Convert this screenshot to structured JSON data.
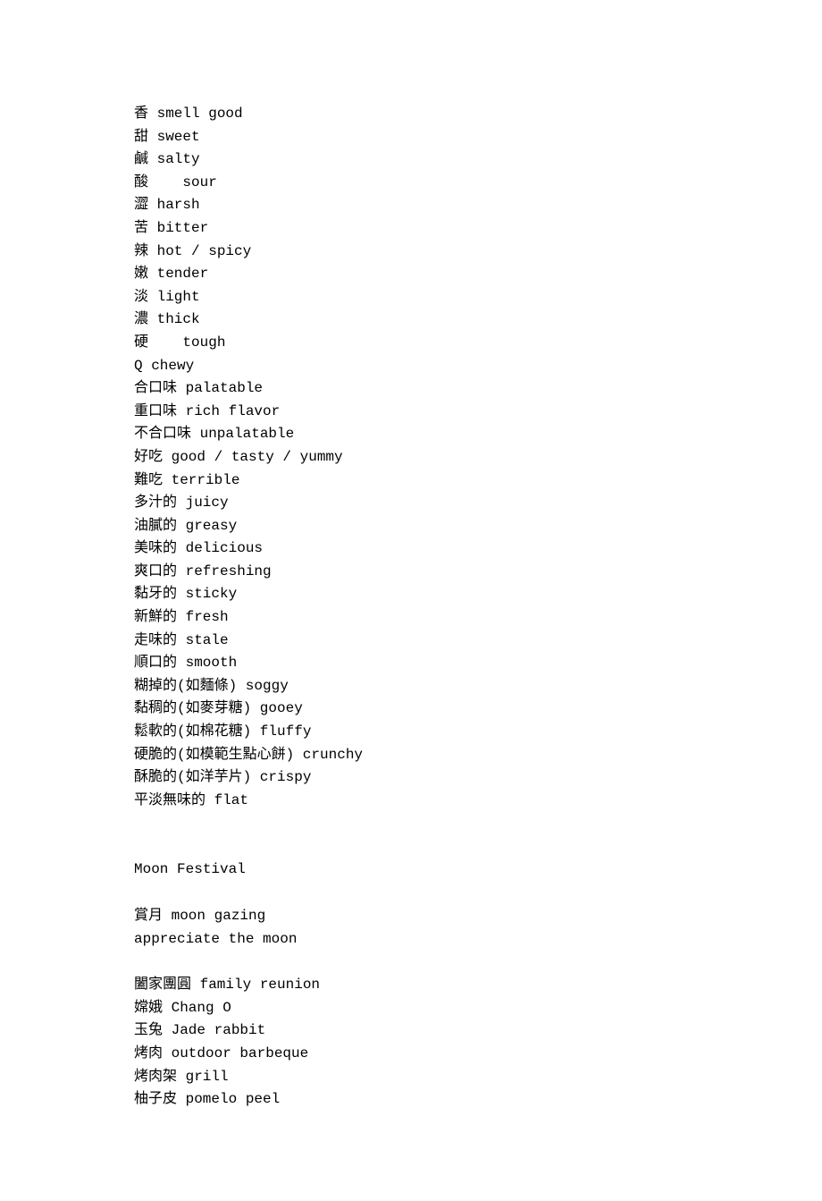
{
  "tastes": [
    {
      "cn": "香",
      "en": "smell good"
    },
    {
      "cn": "甜",
      "en": "sweet"
    },
    {
      "cn": "鹹",
      "en": "salty"
    },
    {
      "cn": "酸   ",
      "en": "sour"
    },
    {
      "cn": "澀",
      "en": "harsh"
    },
    {
      "cn": "苦",
      "en": "bitter"
    },
    {
      "cn": "辣",
      "en": "hot / spicy"
    },
    {
      "cn": "嫩",
      "en": "tender"
    },
    {
      "cn": "淡",
      "en": "light"
    },
    {
      "cn": "濃",
      "en": "thick"
    },
    {
      "cn": "硬   ",
      "en": "tough"
    },
    {
      "cn": "Q",
      "en": "chewy"
    },
    {
      "cn": "合口味",
      "en": "palatable"
    },
    {
      "cn": "重口味",
      "en": "rich flavor"
    },
    {
      "cn": "不合口味",
      "en": "unpalatable"
    },
    {
      "cn": "好吃",
      "en": "good / tasty / yummy"
    },
    {
      "cn": "難吃",
      "en": "terrible"
    },
    {
      "cn": "多汁的",
      "en": "juicy"
    },
    {
      "cn": "油膩的",
      "en": "greasy"
    },
    {
      "cn": "美味的",
      "en": "delicious"
    },
    {
      "cn": "爽口的",
      "en": "refreshing"
    },
    {
      "cn": "黏牙的",
      "en": "sticky"
    },
    {
      "cn": "新鮮的",
      "en": "fresh"
    },
    {
      "cn": "走味的",
      "en": "stale"
    },
    {
      "cn": "順口的",
      "en": "smooth"
    },
    {
      "cn": "糊掉的(如麵條)",
      "en": "soggy"
    },
    {
      "cn": "黏稠的(如麥芽糖)",
      "en": "gooey"
    },
    {
      "cn": "鬆軟的(如棉花糖)",
      "en": "fluffy"
    },
    {
      "cn": "硬脆的(如模範生點心餅)",
      "en": "crunchy"
    },
    {
      "cn": "酥脆的(如洋芋片)",
      "en": "crispy"
    },
    {
      "cn": "平淡無味的",
      "en": "flat"
    }
  ],
  "section2_title": "Moon Festival",
  "moon_block1": [
    {
      "cn": "賞月",
      "en": "moon gazing"
    },
    {
      "cn": "",
      "en": "appreciate the moon"
    }
  ],
  "moon_block2": [
    {
      "cn": "闔家團圓",
      "en": "family reunion"
    },
    {
      "cn": "嫦娥",
      "en": "Chang O"
    },
    {
      "cn": "玉兔",
      "en": "Jade rabbit"
    },
    {
      "cn": "烤肉",
      "en": "outdoor barbeque"
    },
    {
      "cn": "烤肉架",
      "en": "grill"
    },
    {
      "cn": "柚子皮",
      "en": "pomelo peel"
    }
  ]
}
